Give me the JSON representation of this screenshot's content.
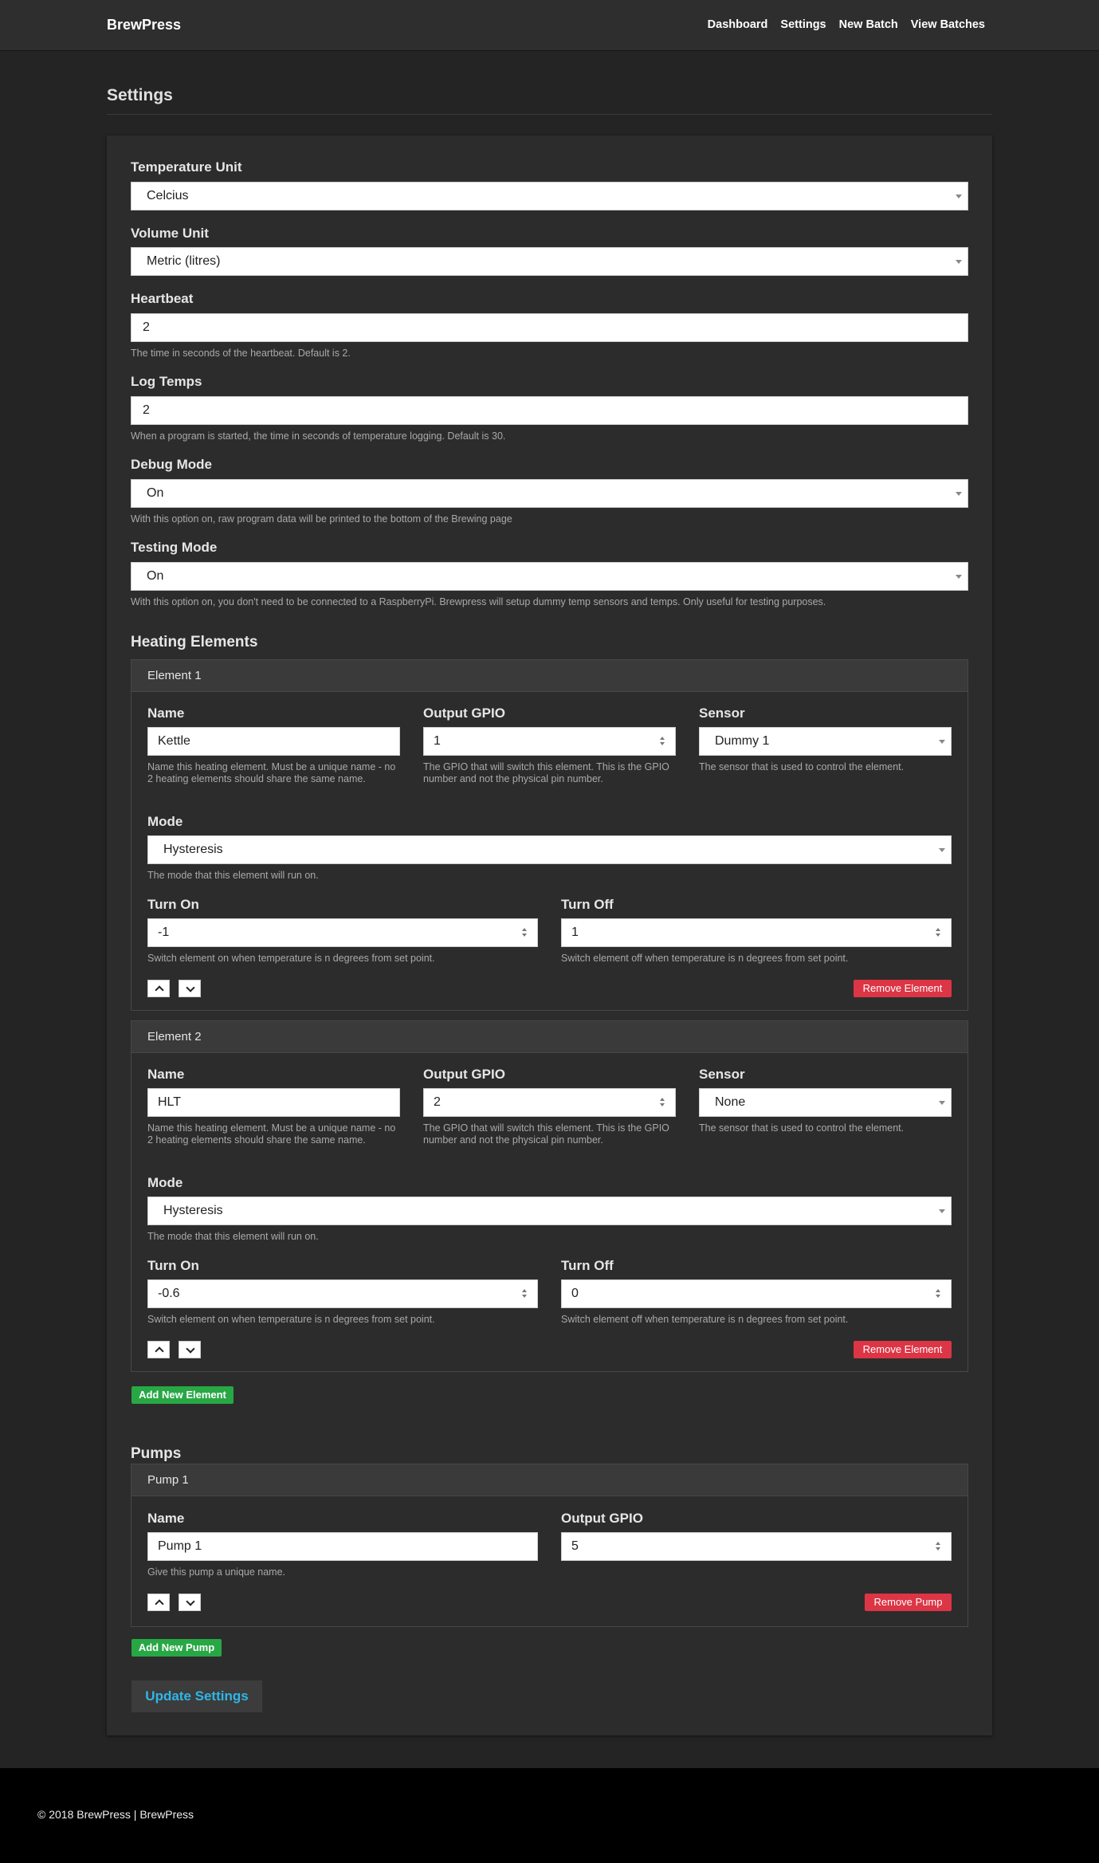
{
  "navbar": {
    "brand": "BrewPress",
    "links": [
      "Dashboard",
      "Settings",
      "New Batch",
      "View Batches"
    ]
  },
  "page": {
    "title": "Settings"
  },
  "general": {
    "temperature_unit": {
      "label": "Temperature Unit",
      "value": "Celcius"
    },
    "volume_unit": {
      "label": "Volume Unit",
      "value": "Metric (litres)"
    },
    "heartbeat": {
      "label": "Heartbeat",
      "value": "2",
      "help": "The time in seconds of the heartbeat. Default is 2."
    },
    "log_temps": {
      "label": "Log Temps",
      "value": "2",
      "help": "When a program is started, the time in seconds of temperature logging. Default is 30."
    },
    "debug_mode": {
      "label": "Debug Mode",
      "value": "On",
      "help": "With this option on, raw program data will be printed to the bottom of the Brewing page"
    },
    "testing_mode": {
      "label": "Testing Mode",
      "value": "On",
      "help": "With this option on, you don't need to be connected to a RaspberryPi. Brewpress will setup dummy temp sensors and temps. Only useful for testing purposes."
    }
  },
  "heating": {
    "title": "Heating Elements",
    "labels": {
      "name": "Name",
      "gpio": "Output GPIO",
      "sensor": "Sensor",
      "mode": "Mode",
      "turn_on": "Turn On",
      "turn_off": "Turn Off"
    },
    "help": {
      "name": "Name this heating element. Must be a unique name - no 2 heating elements should share the same name.",
      "gpio": "The GPIO that will switch this element. This is the GPIO number and not the physical pin number.",
      "sensor": "The sensor that is used to control the element.",
      "mode": "The mode that this element will run on.",
      "turn_on": "Switch element on when temperature is n degrees from set point.",
      "turn_off": "Switch element off when temperature is n degrees from set point."
    },
    "remove_label": "Remove Element",
    "add_label": "Add New Element",
    "elements": [
      {
        "header": "Element 1",
        "name": "Kettle",
        "gpio": "1",
        "sensor": "Dummy 1",
        "mode": "Hysteresis",
        "turn_on": "-1",
        "turn_off": "1"
      },
      {
        "header": "Element 2",
        "name": "HLT",
        "gpio": "2",
        "sensor": "None",
        "mode": "Hysteresis",
        "turn_on": "-0.6",
        "turn_off": "0"
      }
    ]
  },
  "pumps": {
    "title": "Pumps",
    "labels": {
      "name": "Name",
      "gpio": "Output GPIO"
    },
    "help": {
      "name": "Give this pump a unique name."
    },
    "remove_label": "Remove Pump",
    "add_label": "Add New Pump",
    "items": [
      {
        "header": "Pump 1",
        "name": "Pump 1",
        "gpio": "5"
      }
    ]
  },
  "actions": {
    "update_label": "Update Settings"
  },
  "footer": {
    "text": "© 2018 BrewPress | BrewPress"
  }
}
